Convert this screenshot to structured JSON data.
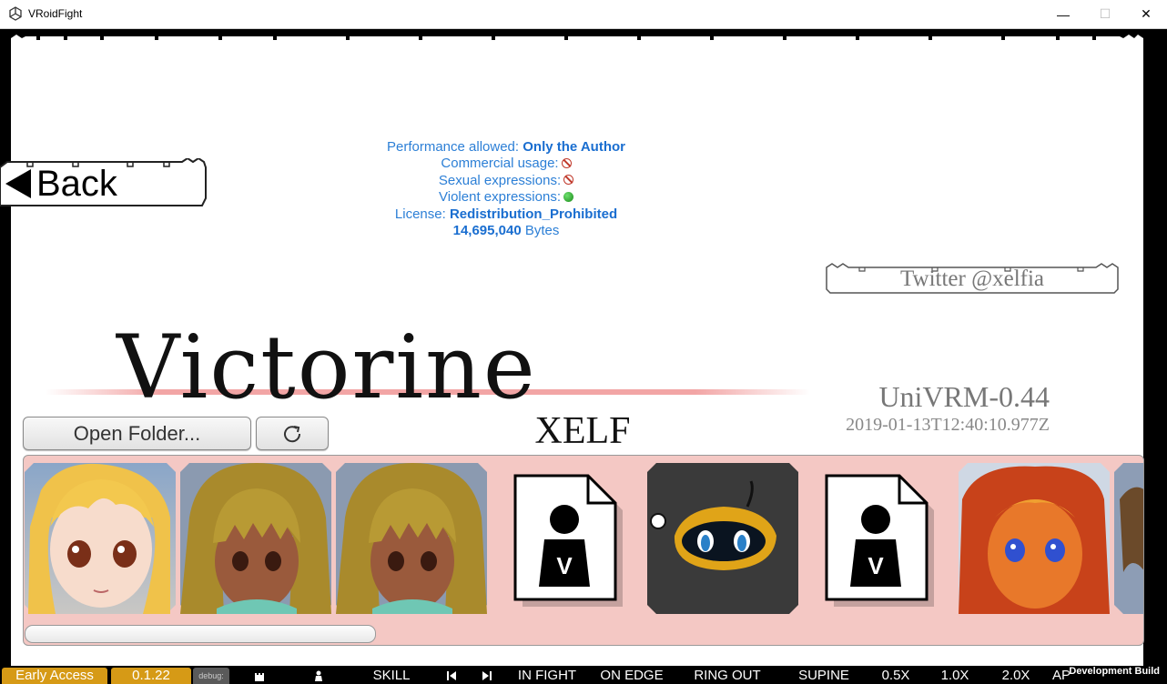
{
  "window": {
    "title": "VRoidFight",
    "minimize_glyph": "—",
    "maximize_glyph": "☐",
    "close_glyph": "✕"
  },
  "nav": {
    "back_label": "Back",
    "twitter_label": "Twitter @xelfia"
  },
  "license_info": {
    "performance_label": "Performance allowed:",
    "performance_value": "Only the Author",
    "commercial_label": "Commercial usage:",
    "commercial_allowed": false,
    "sexual_label": "Sexual expressions:",
    "sexual_allowed": false,
    "violent_label": "Violent expressions:",
    "violent_allowed": true,
    "license_label": "License:",
    "license_value": "Redistribution_Prohibited",
    "size_value": "14,695,040",
    "size_unit": "Bytes"
  },
  "model": {
    "name": "Victorine",
    "author": "XELF",
    "version": "UniVRM-0.44",
    "timestamp": "2019-01-13T12:40:10.977Z"
  },
  "actions": {
    "open_folder_label": "Open Folder...",
    "refresh_icon": "refresh-icon"
  },
  "gallery": {
    "accent_color": "#f4c8c4",
    "items": [
      {
        "kind": "avatar",
        "desc": "blonde"
      },
      {
        "kind": "avatar",
        "desc": "brunette"
      },
      {
        "kind": "avatar",
        "desc": "brunette"
      },
      {
        "kind": "placeholder",
        "letter": "V"
      },
      {
        "kind": "avatar",
        "desc": "cat"
      },
      {
        "kind": "placeholder",
        "letter": "V"
      },
      {
        "kind": "avatar",
        "desc": "fire"
      },
      {
        "kind": "avatar",
        "desc": "partial"
      }
    ]
  },
  "statusbar": {
    "early_access": "Early Access",
    "version": "0.1.22",
    "debug": "debug:",
    "skill": "SKILL",
    "in_fight": "IN FIGHT",
    "on_edge": "ON EDGE",
    "ring_out": "RING OUT",
    "supine": "SUPINE",
    "speed_05": "0.5X",
    "speed_10": "1.0X",
    "speed_20": "2.0X",
    "ap": "AP",
    "dev_build": "Development Build"
  }
}
